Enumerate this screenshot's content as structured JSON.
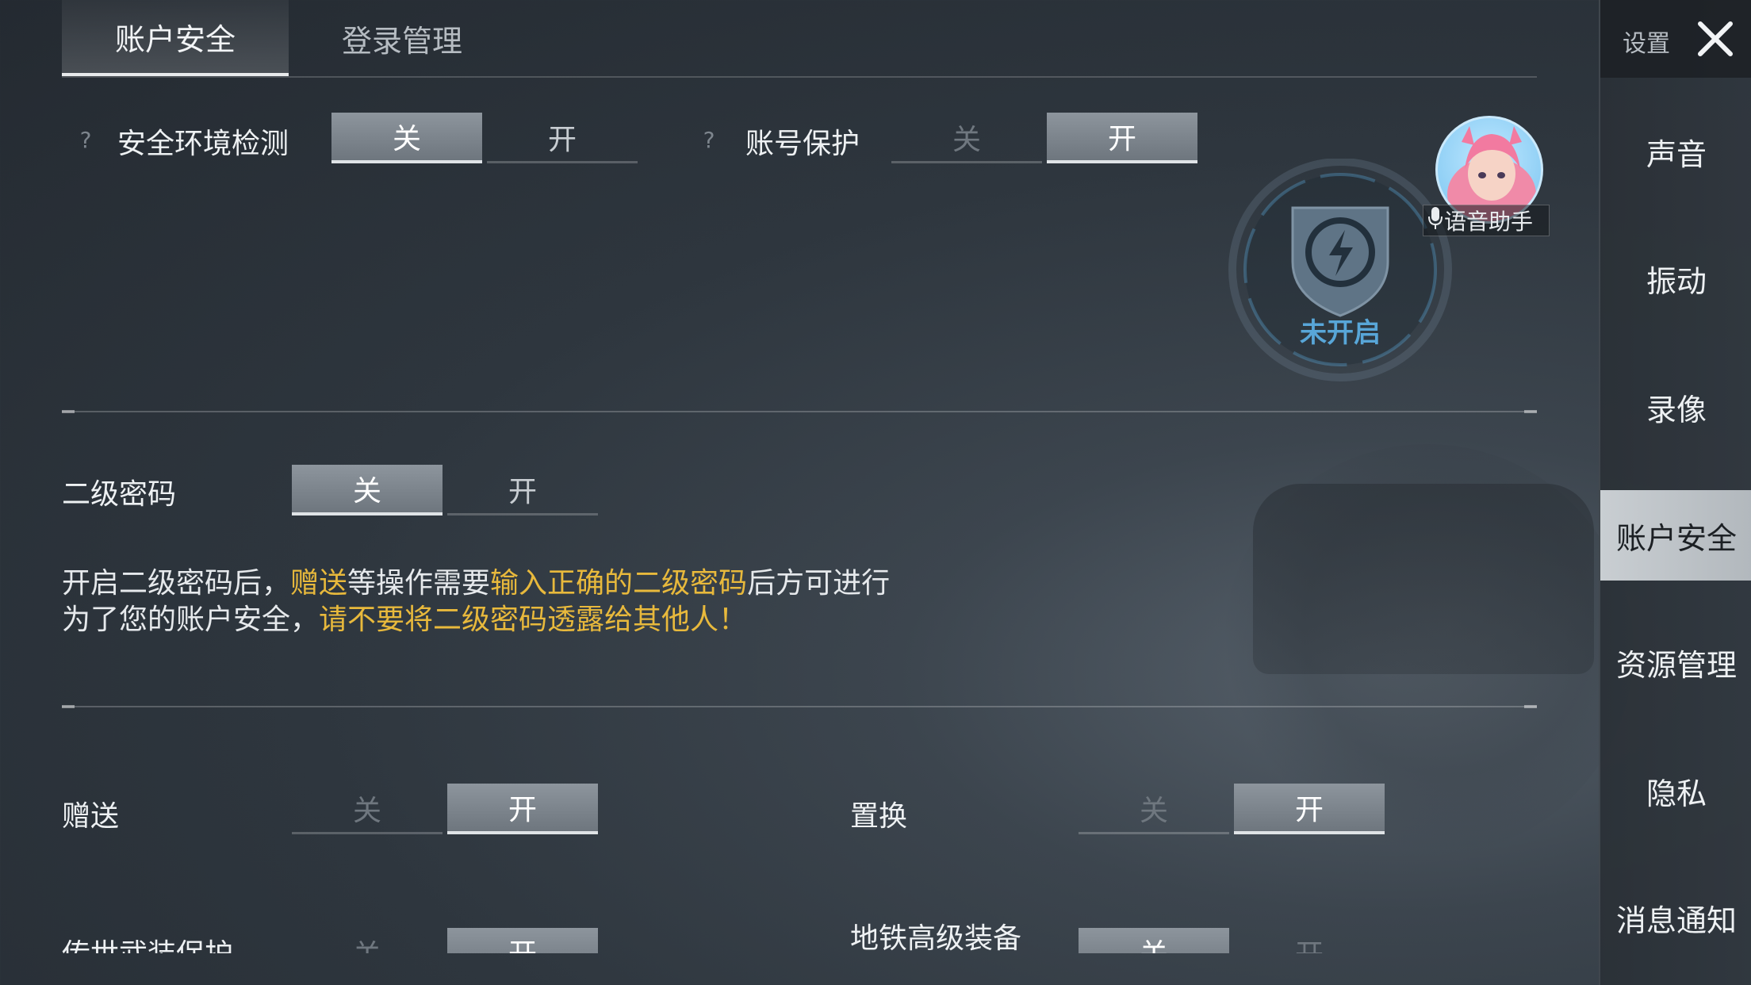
{
  "tabs": [
    {
      "label": "账户安全",
      "active": true
    },
    {
      "label": "登录管理",
      "active": false
    }
  ],
  "security_check": {
    "help": "?",
    "label": "安全环境检测",
    "off": "关",
    "on": "开",
    "value": "off"
  },
  "account_protect": {
    "help": "?",
    "label": "账号保护",
    "off": "关",
    "on": "开",
    "value": "on"
  },
  "badge": {
    "status": "未开启",
    "color": "#58a6d8"
  },
  "voice": {
    "label": "语音助手"
  },
  "second_password": {
    "label": "二级密码",
    "off": "关",
    "on": "开",
    "value": "off"
  },
  "notice": {
    "line1_a": "开启二级密码后，",
    "line1_b": "赠送",
    "line1_c": "等操作需要",
    "line1_d": "输入正确的二级密码",
    "line1_e": "后方可进行",
    "line2_a": "为了您的账户安全，",
    "line2_b": "请不要将二级密码透露给其他人！",
    "highlight_color": "#e8b93c"
  },
  "gift": {
    "label": "赠送",
    "off": "关",
    "on": "开",
    "value": "on"
  },
  "exchange": {
    "label": "置换",
    "off": "关",
    "on": "开",
    "value": "on"
  },
  "legend_weapon": {
    "label": "传世武装保护",
    "off": "关",
    "on": "开",
    "value": "on"
  },
  "metro_gear": {
    "label": "地铁高级装备",
    "off": "关",
    "on": "开",
    "value": "off"
  },
  "sidebar": {
    "header": "设置",
    "items": [
      {
        "label": "声音"
      },
      {
        "label": "振动"
      },
      {
        "label": "录像"
      },
      {
        "label": "账户安全",
        "active": true
      },
      {
        "label": "资源管理"
      },
      {
        "label": "隐私"
      },
      {
        "label": "消息通知"
      }
    ]
  }
}
